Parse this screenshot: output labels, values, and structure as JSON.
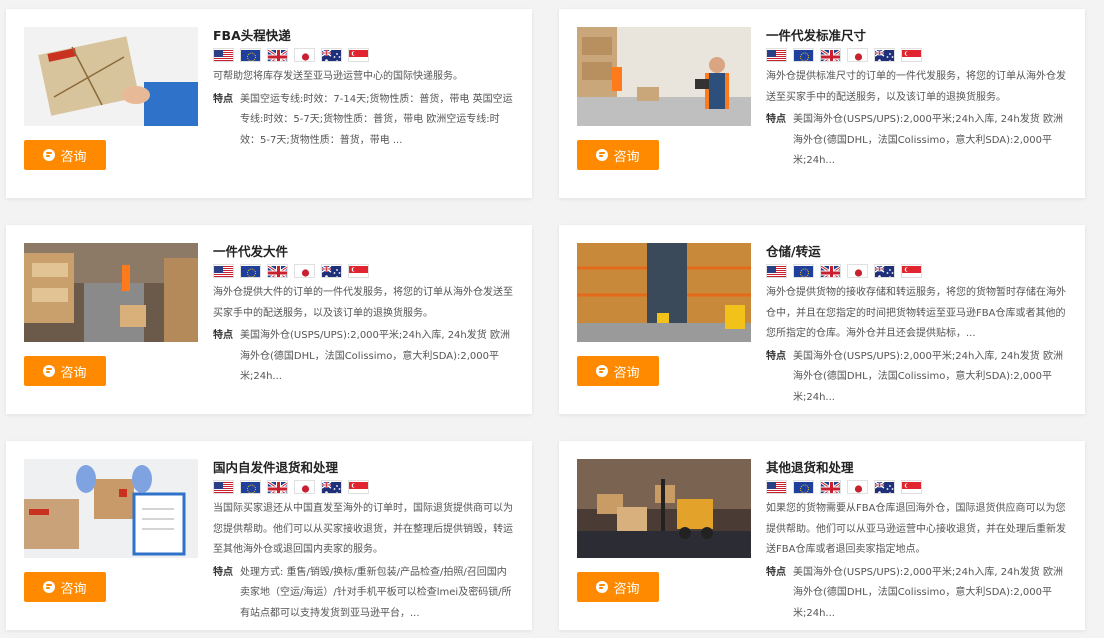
{
  "consult_label": "咨询",
  "feature_label": "特点",
  "flags": [
    "us-flag",
    "eu-flag",
    "uk-flag",
    "jp-flag",
    "au-flag",
    "sg-flag"
  ],
  "colors": {
    "accent": "#ff8a00",
    "background": "#f3f3f3"
  },
  "cards": [
    {
      "title": "FBA头程快递",
      "image": "express-parcel-hand-image",
      "description": "可帮助您将库存发送至亚马逊运营中心的国际快递服务。",
      "features": "美国空运专线:时效：7-14天;货物性质：普货，带电 英国空运专线:时效：5-7天;货物性质：普货，带电 欧洲空运专线:时效：5-7天;货物性质：普货，带电 ..."
    },
    {
      "title": "一件代发标准尺寸",
      "image": "warehouse-worker-scanner-image",
      "description": "海外仓提供标准尺寸的订单的一件代发服务，将您的订单从海外仓发送至买家手中的配送服务，以及该订单的退换货服务。",
      "features": "美国海外仓(USPS/UPS):2,000平米;24h入库, 24h发货 欧洲海外仓(德国DHL，法国Colissimo，意大利SDA):2,000平米;24h..."
    },
    {
      "title": "一件代发大件",
      "image": "warehouse-boxes-aisle-image",
      "description": "海外仓提供大件的订单的一件代发服务，将您的订单从海外仓发送至买家手中的配送服务，以及该订单的退换货服务。",
      "features": "美国海外仓(USPS/UPS):2,000平米;24h入库, 24h发货 欧洲海外仓(德国DHL，法国Colissimo，意大利SDA):2,000平米;24h..."
    },
    {
      "title": "仓储/转运",
      "image": "warehouse-shelves-forklift-image",
      "description": "海外仓提供货物的接收存储和转运服务，将您的货物暂时存储在海外仓中，并且在您指定的时间把货物转运至亚马逊FBA仓库或者其他的您所指定的仓库。海外仓并且还会提供贴标，...",
      "features": "美国海外仓(USPS/UPS):2,000平米;24h入库, 24h发货 欧洲海外仓(德国DHL，法国Colissimo，意大利SDA):2,000平米;24h..."
    },
    {
      "title": "国内自发件退货和处理",
      "image": "gloved-hands-parcel-image",
      "description": "当国际买家退还从中国直发至海外的订单时，国际退货提供商可以为您提供帮助。他们可以从买家接收退货，并在整理后提供销毁，转运至其他海外仓或退回国内卖家的服务。",
      "features": "处理方式: 重售/销毁/换标/重新包装/产品检查/拍照/召回国内卖家地（空运/海运）/针对手机平板可以检查lmei及密码锁/所有站点都可以支持发货到亚马逊平台，..."
    },
    {
      "title": "其他退货和处理",
      "image": "toy-forklift-boxes-laptop-image",
      "description": "如果您的货物需要从FBA仓库退回海外仓，国际退货供应商可以为您提供帮助。他们可以从亚马逊运营中心接收退货，并在处理后重新发送FBA仓库或者退回卖家指定地点。",
      "features": "美国海外仓(USPS/UPS):2,000平米;24h入库, 24h发货 欧洲海外仓(德国DHL，法国Colissimo，意大利SDA):2,000平米;24h..."
    }
  ]
}
